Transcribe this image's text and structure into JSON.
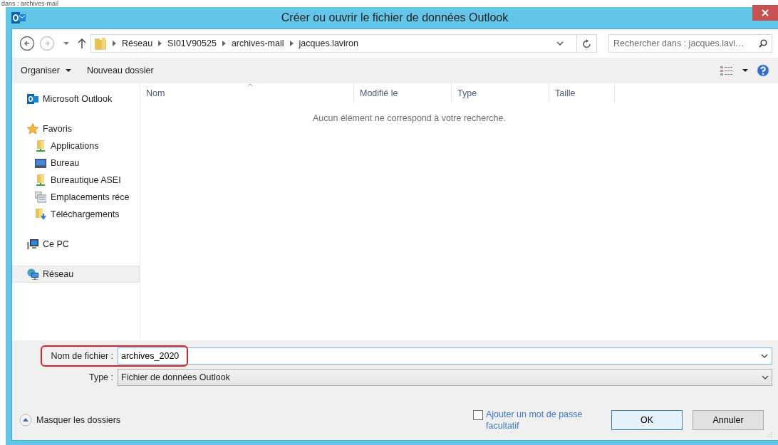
{
  "background_window": {
    "search_text": "dans : archives-mail"
  },
  "window": {
    "title": "Créer ou ouvrir le fichier de données Outlook"
  },
  "nav": {
    "breadcrumb": [
      "Réseau",
      "SI01V90525",
      "archives-mail",
      "jacques.laviron"
    ],
    "back_disabled": false,
    "forward_disabled": true,
    "search": {
      "placeholder": "Rechercher dans : jacques.lavi…"
    }
  },
  "toolbar": {
    "buttons": [
      {
        "label": "Organiser",
        "dropdown": true
      },
      {
        "label": "Nouveau dossier",
        "dropdown": false
      }
    ]
  },
  "sidebar": {
    "items": [
      {
        "label": "Microsoft Outlook",
        "kind": "outlook",
        "selected": false
      },
      {
        "label": "Favoris",
        "kind": "star",
        "selected": false,
        "children": [
          {
            "label": "Applications",
            "kind": "netfolder",
            "selected": false
          },
          {
            "label": "Bureau",
            "kind": "desktop",
            "selected": false
          },
          {
            "label": "Bureautique ASEI",
            "kind": "netfolder",
            "selected": false
          },
          {
            "label": "Emplacements réce",
            "kind": "recent",
            "selected": false
          },
          {
            "label": "Téléchargements",
            "kind": "downloads",
            "selected": false
          }
        ]
      },
      {
        "label": "Ce PC",
        "kind": "computer",
        "selected": false
      },
      {
        "label": "Réseau",
        "kind": "network",
        "selected": true
      }
    ]
  },
  "file_list": {
    "columns": [
      {
        "label": "Nom",
        "sorted": true
      },
      {
        "label": "Modifié le",
        "sorted": false
      },
      {
        "label": "Type",
        "sorted": false
      },
      {
        "label": "Taille",
        "sorted": false
      }
    ],
    "empty_message": "Aucun élément ne correspond à votre recherche."
  },
  "form": {
    "filename": {
      "label": "Nom de fichier :",
      "value": "archives_2020",
      "highlighted": true
    },
    "type": {
      "label": "Type :",
      "value": "Fichier de données Outlook"
    }
  },
  "footer": {
    "toggle": "Masquer les dossiers",
    "password": {
      "label": "Ajouter un mot de passe facultatif",
      "checked": false
    },
    "buttons": [
      {
        "label": "OK",
        "default": true
      },
      {
        "label": "Annuler",
        "default": false
      }
    ]
  }
}
